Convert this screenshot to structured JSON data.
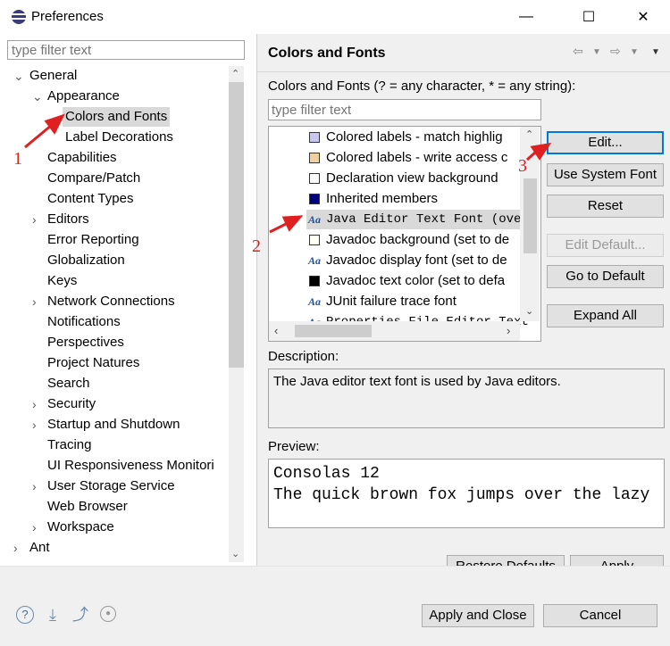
{
  "window": {
    "title": "Preferences",
    "minimize": "—",
    "maximize": "☐",
    "close": "✕"
  },
  "left": {
    "filter_placeholder": "type filter text",
    "tree": [
      {
        "label": "General",
        "level": 0,
        "toggle": "v"
      },
      {
        "label": "Appearance",
        "level": 1,
        "toggle": "v"
      },
      {
        "label": "Colors and Fonts",
        "level": 2,
        "selected": true
      },
      {
        "label": "Label Decorations",
        "level": 2
      },
      {
        "label": "Capabilities",
        "level": 1
      },
      {
        "label": "Compare/Patch",
        "level": 1
      },
      {
        "label": "Content Types",
        "level": 1
      },
      {
        "label": "Editors",
        "level": 1,
        "toggle": ">"
      },
      {
        "label": "Error Reporting",
        "level": 1
      },
      {
        "label": "Globalization",
        "level": 1
      },
      {
        "label": "Keys",
        "level": 1
      },
      {
        "label": "Network Connections",
        "level": 1,
        "toggle": ">"
      },
      {
        "label": "Notifications",
        "level": 1
      },
      {
        "label": "Perspectives",
        "level": 1
      },
      {
        "label": "Project Natures",
        "level": 1
      },
      {
        "label": "Search",
        "level": 1
      },
      {
        "label": "Security",
        "level": 1,
        "toggle": ">"
      },
      {
        "label": "Startup and Shutdown",
        "level": 1,
        "toggle": ">"
      },
      {
        "label": "Tracing",
        "level": 1
      },
      {
        "label": "UI Responsiveness Monitori",
        "level": 1
      },
      {
        "label": "User Storage Service",
        "level": 1,
        "toggle": ">"
      },
      {
        "label": "Web Browser",
        "level": 1
      },
      {
        "label": "Workspace",
        "level": 1,
        "toggle": ">"
      },
      {
        "label": "Ant",
        "level": 0,
        "toggle": ">"
      }
    ]
  },
  "right": {
    "title": "Colors and Fonts",
    "filter_label": "Colors and Fonts (? = any character, * = any string):",
    "filter_placeholder": "type filter text",
    "list": [
      {
        "label": "Colored labels - match highlig",
        "kind": "color",
        "color": "#c8c8f0"
      },
      {
        "label": "Colored labels - write access c",
        "kind": "color",
        "color": "#f0d0a0"
      },
      {
        "label": "Declaration view background",
        "kind": "color",
        "color": "#ffffff"
      },
      {
        "label": "Inherited members",
        "kind": "color",
        "color": "#000080"
      },
      {
        "label": "Java Editor Text Font (over",
        "kind": "font",
        "mono": true,
        "selected": true
      },
      {
        "label": "Javadoc background (set to de",
        "kind": "color",
        "color": "#fffff0"
      },
      {
        "label": "Javadoc display font (set to de",
        "kind": "font"
      },
      {
        "label": "Javadoc text color (set to defa",
        "kind": "color",
        "color": "#000000"
      },
      {
        "label": "JUnit failure trace font",
        "kind": "font"
      },
      {
        "label": "Properties File Editor Text",
        "kind": "font",
        "mono": true
      }
    ],
    "buttons": {
      "edit": "Edit...",
      "use_system_font": "Use System Font",
      "reset": "Reset",
      "edit_default": "Edit Default...",
      "go_to_default": "Go to Default",
      "expand_all": "Expand All"
    },
    "description_label": "Description:",
    "description": "The Java editor text font is used by Java editors.",
    "preview_label": "Preview:",
    "preview_lines": [
      "Consolas 12",
      "The quick brown fox jumps over the lazy"
    ],
    "restore_defaults": "Restore Defaults",
    "apply": "Apply"
  },
  "bottom": {
    "apply_close": "Apply and Close",
    "cancel": "Cancel"
  },
  "annotations": [
    "1",
    "2",
    "3"
  ],
  "colors": {
    "selection": "#cce8ff",
    "annotation": "#e02020",
    "panel": "#f0f0f0"
  }
}
